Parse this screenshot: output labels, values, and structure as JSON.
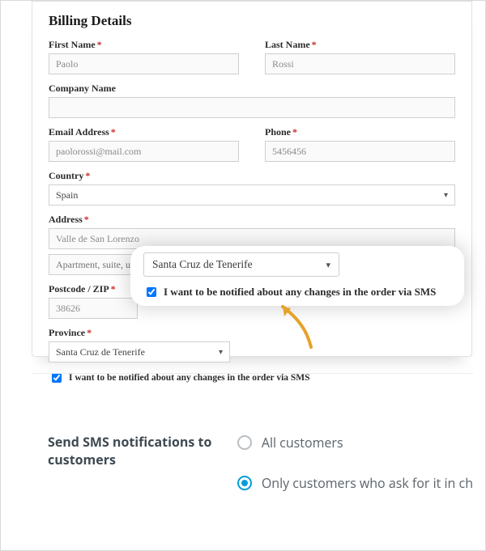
{
  "billing": {
    "title": "Billing Details",
    "first_name": {
      "label": "First Name",
      "value": "Paolo"
    },
    "last_name": {
      "label": "Last Name",
      "value": "Rossi"
    },
    "company": {
      "label": "Company Name",
      "value": ""
    },
    "email": {
      "label": "Email Address",
      "value": "paolorossi@mail.com"
    },
    "phone": {
      "label": "Phone",
      "value": "5456456"
    },
    "country": {
      "label": "Country",
      "value": "Spain"
    },
    "address": {
      "label": "Address",
      "value": "Valle de San Lorenzo"
    },
    "address2_placeholder": "Apartment, suite, unit etc. (optional)",
    "postcode": {
      "label": "Postcode / ZIP",
      "value": "38626"
    },
    "province": {
      "label": "Province",
      "value": "Santa Cruz de Tenerife"
    },
    "sms_checkbox_label": "I want to be notified about any changes in the order via SMS"
  },
  "callout": {
    "province_value": "Santa Cruz de Tenerife",
    "sms_checkbox_label": "I want to be notified about any changes in the order via SMS"
  },
  "settings": {
    "heading": "Send SMS notifications to customers",
    "option_all": "All customers",
    "option_opt_in": "Only customers who ask for it in ch",
    "selected": "opt_in"
  },
  "colors": {
    "required": "#c9302c",
    "accent": "#049dd9",
    "arrow": "#e5a22b"
  }
}
